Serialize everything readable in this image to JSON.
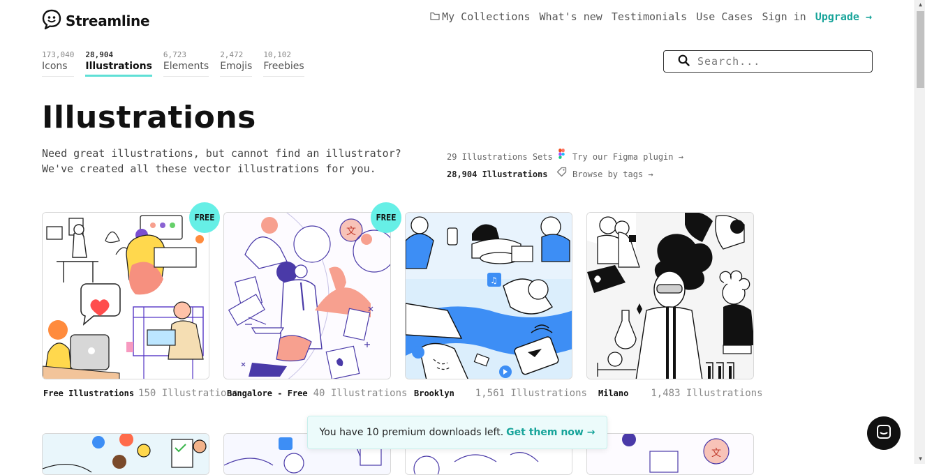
{
  "brand": {
    "name": "Streamline"
  },
  "nav": {
    "collections": "My Collections",
    "whats_new": "What's new",
    "testimonials": "Testimonials",
    "use_cases": "Use Cases",
    "sign_in": "Sign in",
    "upgrade": "Upgrade →"
  },
  "categories": [
    {
      "count": "173,040",
      "label": "Icons"
    },
    {
      "count": "28,904",
      "label": "Illustrations"
    },
    {
      "count": "6,723",
      "label": "Elements"
    },
    {
      "count": "2,472",
      "label": "Emojis"
    },
    {
      "count": "10,102",
      "label": "Freebies"
    }
  ],
  "search": {
    "placeholder": "Search..."
  },
  "page": {
    "title": "Illustrations",
    "description": "Need great illustrations, but cannot find an illustrator? We've created all these vector illustrations for you.",
    "sets": "29 Illustrations Sets",
    "total": "28,904 Illustrations",
    "figma": "Try our Figma plugin →",
    "tags": "Browse by tags →"
  },
  "cards": [
    {
      "name": "Free Illustrations",
      "count": "150 Illustrations",
      "badge": "FREE"
    },
    {
      "name": "Bangalore - Free",
      "count": "40 Illustrations",
      "badge": "FREE"
    },
    {
      "name": "Brooklyn",
      "count": "1,561 Illustrations"
    },
    {
      "name": "Milano",
      "count": "1,483 Illustrations"
    }
  ],
  "toast": {
    "text": "You have 10 premium downloads left.",
    "cta": "Get them now →"
  },
  "colors": {
    "accent": "#17a49a",
    "badge": "#66efe6",
    "brooklyn_blue": "#3d8ef5",
    "coral": "#f7a08f",
    "indigo": "#4a3aa8"
  },
  "icons": [
    "chat-bubble-logo-icon",
    "folder-icon",
    "search-icon",
    "figma-icon",
    "tag-icon",
    "messenger-icon"
  ]
}
